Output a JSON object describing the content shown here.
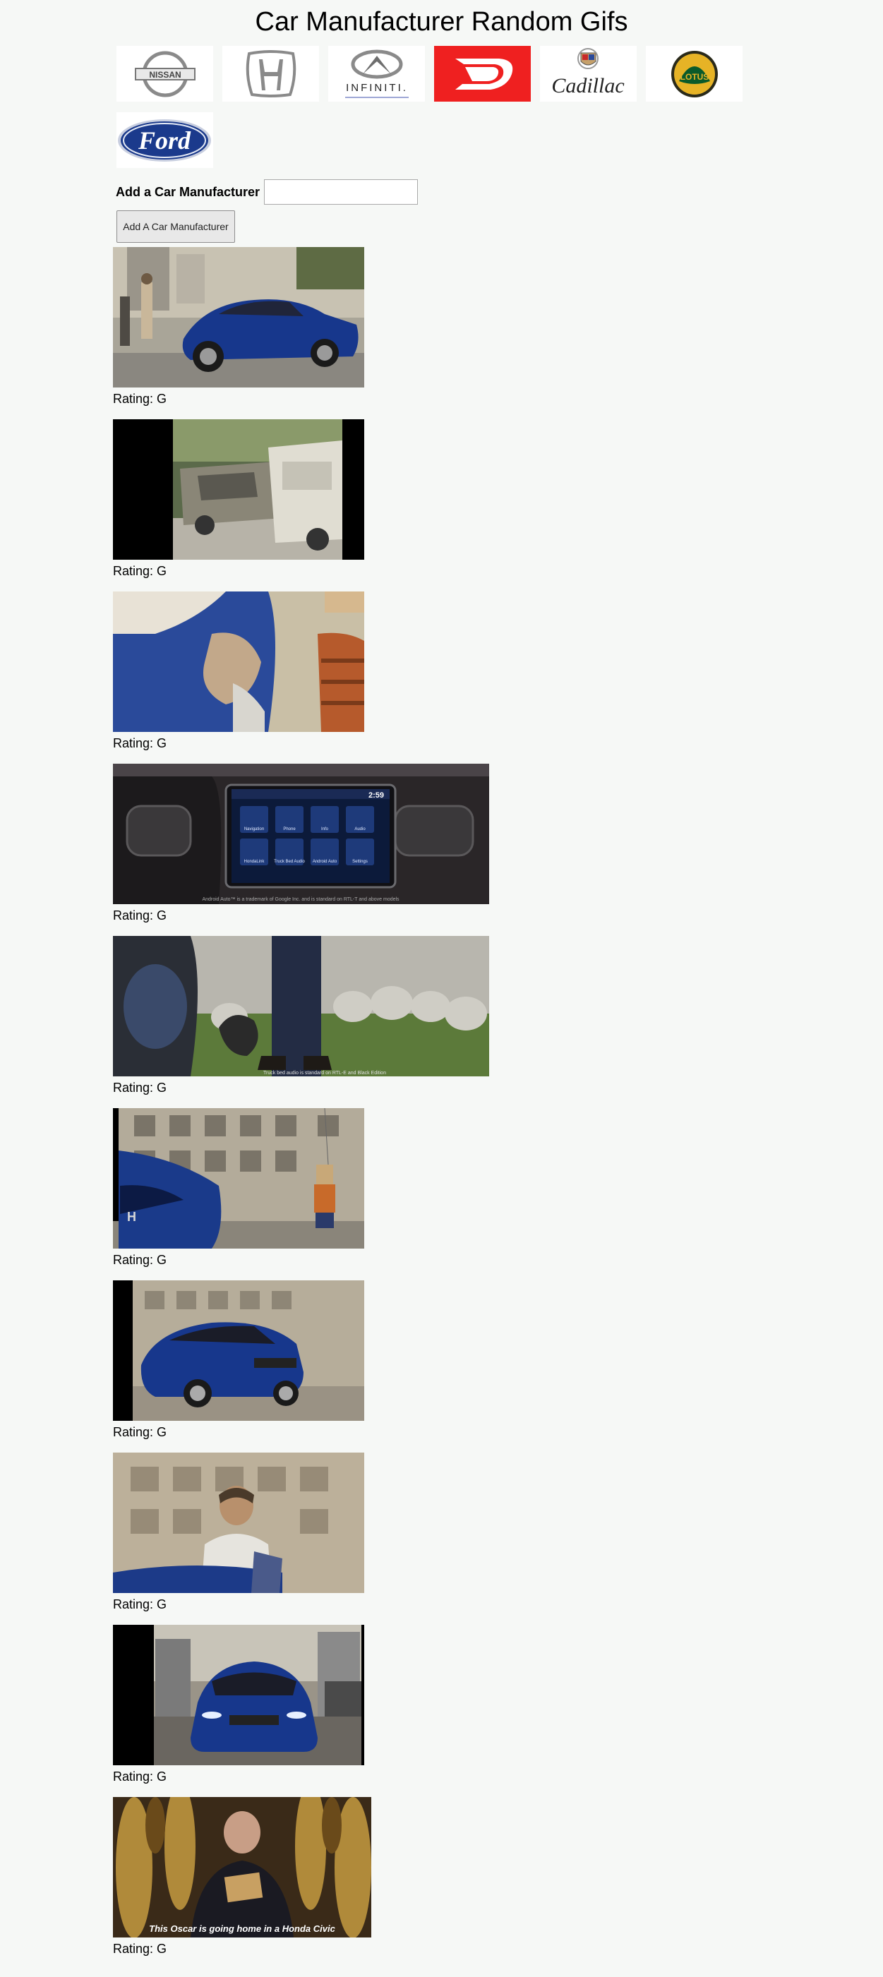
{
  "page": {
    "title": "Car Manufacturer Random Gifs"
  },
  "brands": [
    {
      "name": "Nissan",
      "logo_text": "NISSAN"
    },
    {
      "name": "Honda"
    },
    {
      "name": "Infiniti",
      "logo_text": "INFINITI."
    },
    {
      "name": "Daihatsu"
    },
    {
      "name": "Cadillac",
      "logo_text": "Cadillac"
    },
    {
      "name": "Lotus",
      "logo_text": "LOTUS"
    },
    {
      "name": "Ford",
      "logo_text": "Ford"
    }
  ],
  "form": {
    "label": "Add a Car Manufacturer",
    "input_value": "",
    "button_label": "Add A Car Manufacturer"
  },
  "gifs": [
    {
      "rating": "Rating: G"
    },
    {
      "rating": "Rating: G"
    },
    {
      "rating": "Rating: G"
    },
    {
      "rating": "Rating: G",
      "screen": {
        "time": "2:59",
        "apps": [
          "Navigation",
          "Phone",
          "Info",
          "Audio",
          "HondaLink",
          "Truck Bed Audio",
          "Android Auto",
          "Settings"
        ],
        "caption": "Android Auto™ is a trademark of Google Inc. and is standard on RTL-T and above models"
      }
    },
    {
      "rating": "Rating: G",
      "caption": "Truck bed audio is standard on RTL-E and Black Edition"
    },
    {
      "rating": "Rating: G"
    },
    {
      "rating": "Rating: G"
    },
    {
      "rating": "Rating: G"
    },
    {
      "rating": "Rating: G"
    },
    {
      "rating": "Rating: G",
      "caption": "This Oscar is going home in a Honda Civic"
    }
  ]
}
